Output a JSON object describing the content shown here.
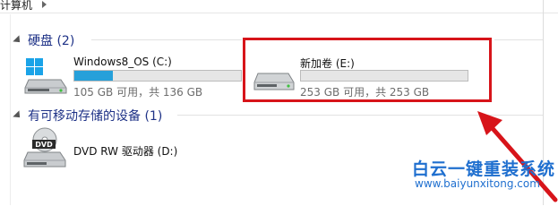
{
  "breadcrumb": {
    "label": "计算机"
  },
  "groups": {
    "hard_disks": {
      "title": "硬盘 (2)"
    },
    "removable": {
      "title": "有可移动存储的设备 (1)"
    }
  },
  "drives": {
    "c": {
      "name": "Windows8_OS (C:)",
      "space": "105 GB 可用，共 136 GB",
      "used_fraction": 0.23
    },
    "e": {
      "name": "新加卷 (E:)",
      "space": "253 GB 可用，共 253 GB",
      "used_fraction": 0.0
    },
    "d": {
      "name": "DVD RW 驱动器 (D:)",
      "icon_label": "DVD"
    }
  },
  "watermark": {
    "title": "白云一键重装系统",
    "url": "www.baiyunxitong.com"
  },
  "colors": {
    "accent": "#26a0da",
    "highlight": "#d7141a",
    "group_title": "#1e3287"
  }
}
